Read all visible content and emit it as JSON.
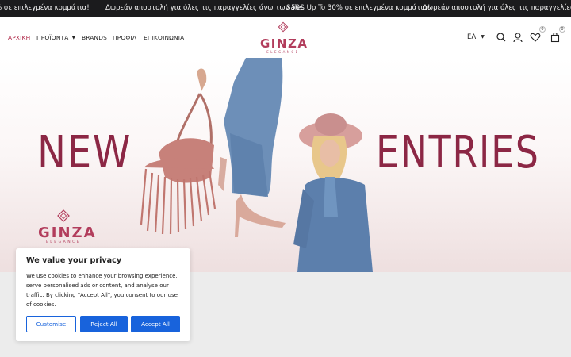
{
  "ticker": {
    "items": [
      "% σε επιλεγμένα κομμάτια!",
      "Δωρεάν αποστολή για όλες τις παραγγελίες άνω των 50€",
      "Sales Up To 30% σε επιλεγμένα κομμάτια!",
      "Δωρεάν αποστολή για όλες τις παραγγελίες άνω"
    ]
  },
  "nav": {
    "home": "ΑΡΧΙΚΗ",
    "products": "ΠΡΟΪΟΝΤΑ",
    "brands": "BRANDS",
    "profile": "ΠΡΟΦΙΛ",
    "contact": "ΕΠΙΚΟΙΝΩΝΙΑ"
  },
  "logo": {
    "word": "GINZA",
    "sub": "ELEGANCE"
  },
  "header": {
    "language": "ΕΛ",
    "wishlist_count": "0",
    "cart_count": "0"
  },
  "hero": {
    "left_text": "NEW",
    "right_text": "ENTRIES",
    "logo_word": "GINZA",
    "logo_sub": "ELEGANCE"
  },
  "cookie": {
    "title": "We value your privacy",
    "body": "We use cookies to enhance your browsing experience, serve personalised ads or content, and analyse our traffic. By clicking \"Accept All\", you consent to our use of cookies.",
    "customise": "Customise",
    "reject": "Reject All",
    "accept": "Accept All"
  },
  "colors": {
    "brand": "#8c2745",
    "accent": "#1863dc",
    "ticker_bg": "#1b1b1d"
  }
}
